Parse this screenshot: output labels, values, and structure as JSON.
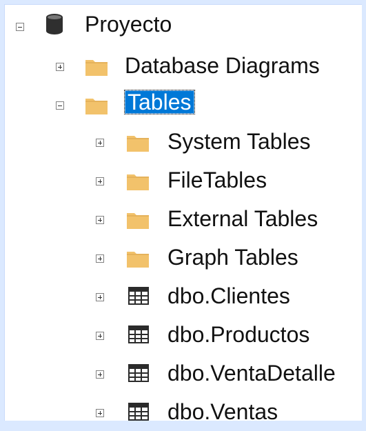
{
  "colors": {
    "accent": "#0078d7",
    "folder": "#f2c26b",
    "frame": "#dbe9ff"
  },
  "tree": {
    "root": {
      "label": "Proyecto",
      "icon": "database-icon",
      "state": "expanded"
    },
    "database_diagrams": {
      "label": "Database Diagrams",
      "icon": "folder-icon",
      "state": "collapsed"
    },
    "tables": {
      "label": "Tables",
      "icon": "folder-icon",
      "state": "expanded",
      "selected": true
    },
    "children": [
      {
        "label": "System Tables",
        "icon": "folder-icon",
        "state": "collapsed"
      },
      {
        "label": "FileTables",
        "icon": "folder-icon",
        "state": "collapsed"
      },
      {
        "label": "External Tables",
        "icon": "folder-icon",
        "state": "collapsed"
      },
      {
        "label": "Graph Tables",
        "icon": "folder-icon",
        "state": "collapsed"
      },
      {
        "label": "dbo.Clientes",
        "icon": "table-icon",
        "state": "collapsed"
      },
      {
        "label": "dbo.Productos",
        "icon": "table-icon",
        "state": "collapsed"
      },
      {
        "label": "dbo.VentaDetalle",
        "icon": "table-icon",
        "state": "collapsed"
      },
      {
        "label": "dbo.Ventas",
        "icon": "table-icon",
        "state": "collapsed"
      }
    ]
  }
}
